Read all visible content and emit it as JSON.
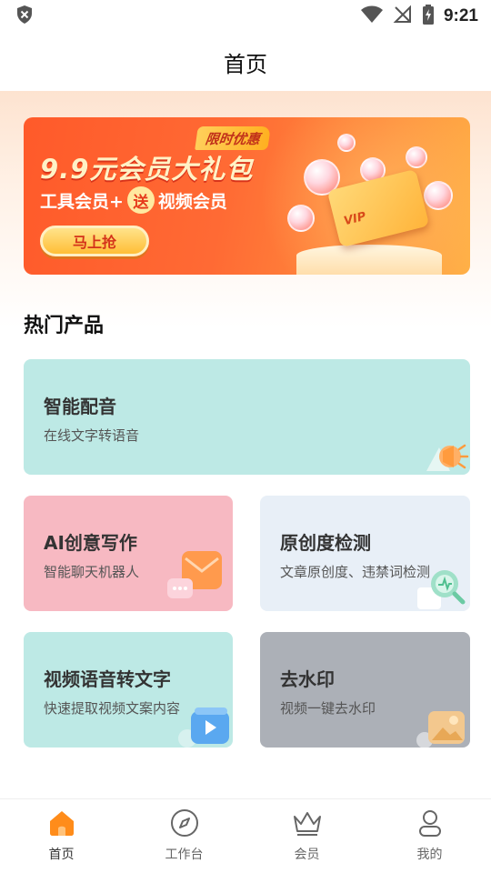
{
  "status_bar": {
    "time": "9:21"
  },
  "header": {
    "title": "首页"
  },
  "banner": {
    "promo_tag": "限时优惠",
    "title": "9.9元会员大礼包",
    "subtitle_left": "工具会员+",
    "subtitle_badge": "送",
    "subtitle_right": "视频会员",
    "cta": "马上抢",
    "vip_label": "VIP",
    "colors": {
      "background": "#ff5a2a",
      "cta": "#ffbe36"
    }
  },
  "section": {
    "title": "热门产品"
  },
  "products": [
    {
      "title": "智能配音",
      "desc": "在线文字转语音",
      "icon": "megaphone-icon",
      "color": "#bde9e5"
    },
    {
      "title": "AI创意写作",
      "desc": "智能聊天机器人",
      "icon": "mail-chat-icon",
      "color": "#f7b9c2"
    },
    {
      "title": "原创度检测",
      "desc": "文章原创度、违禁词检测",
      "icon": "magnifier-check-icon",
      "color": "#e8eff7"
    },
    {
      "title": "视频语音转文字",
      "desc": "快速提取视频文案内容",
      "icon": "video-play-icon",
      "color": "#bde9e5"
    },
    {
      "title": "去水印",
      "desc": "视频一键去水印",
      "icon": "image-icon",
      "color": "#acb0b7"
    }
  ],
  "nav": {
    "items": [
      {
        "label": "首页",
        "icon": "home-icon",
        "active": true
      },
      {
        "label": "工作台",
        "icon": "compass-icon",
        "active": false
      },
      {
        "label": "会员",
        "icon": "crown-icon",
        "active": false
      },
      {
        "label": "我的",
        "icon": "user-icon",
        "active": false
      }
    ],
    "active_color": "#ff8c1a"
  }
}
